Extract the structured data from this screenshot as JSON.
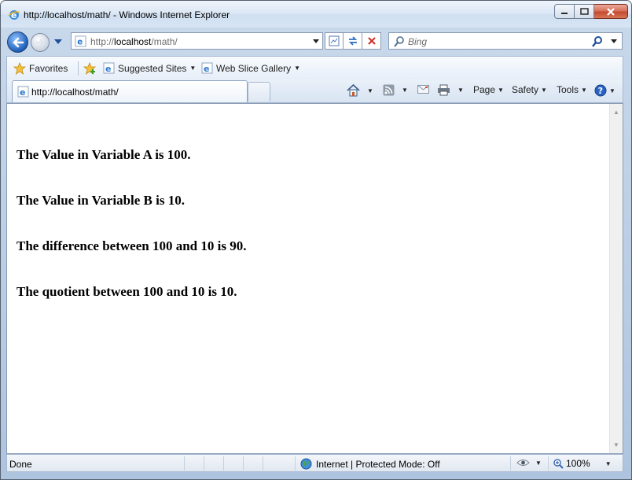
{
  "window": {
    "title": "http://localhost/math/ - Windows Internet Explorer"
  },
  "nav": {
    "address_host_prefix": "http://",
    "address_host": "localhost",
    "address_path": "/math/",
    "search_placeholder": "Bing"
  },
  "favorites": {
    "favorites_label": "Favorites",
    "suggested_label": "Suggested Sites",
    "webslice_label": "Web Slice Gallery"
  },
  "tabs": [
    {
      "label": "http://localhost/math/"
    }
  ],
  "commandbar": {
    "page_label": "Page",
    "safety_label": "Safety",
    "tools_label": "Tools"
  },
  "content": {
    "lines": [
      "The Value in Variable A is 100.",
      "The Value in Variable B is 10.",
      "The difference between 100 and 10 is 90.",
      "The quotient between 100 and 10 is 10."
    ]
  },
  "status": {
    "text": "Done",
    "zone": "Internet | Protected Mode: Off",
    "zoom": "100%"
  },
  "colors": {
    "accent": "#1e5fb8",
    "close_button": "#c44a2f",
    "frame": "#aec4de"
  },
  "icons": {
    "title": "ie-logo-icon",
    "back": "back-arrow-icon",
    "forward": "forward-arrow-icon",
    "compat": "compatibility-view-icon",
    "refresh": "refresh-icon",
    "stop": "stop-icon",
    "search": "search-icon",
    "favorites": "star-icon",
    "home": "home-icon",
    "feeds": "rss-feed-icon",
    "mail": "mail-icon",
    "print": "printer-icon",
    "help": "help-icon",
    "globe": "globe-icon",
    "zoom": "zoom-icon"
  }
}
